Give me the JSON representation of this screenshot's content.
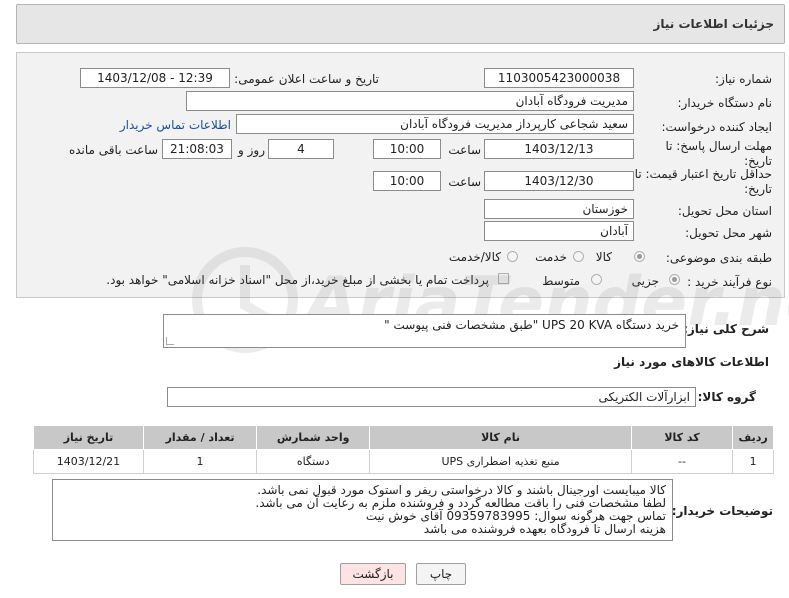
{
  "page_title": "جزئیات اطلاعات نیاز",
  "labels": {
    "need_number": "شماره نیاز:",
    "announce_datetime": "تاریخ و ساعت اعلان عمومی:",
    "buyer_org": "نام دستگاه خریدار:",
    "requester": "ایجاد کننده درخواست:",
    "reply_deadline": "مهلت ارسال پاسخ: تا تاریخ:",
    "price_validity": "حداقل تاریخ اعتبار قیمت: تا تاریخ:",
    "time": "ساعت",
    "day_and": "روز و",
    "remaining_time": "ساعت باقی مانده",
    "province": "استان محل تحویل:",
    "city": "شهر محل تحویل:",
    "category": "طبقه بندی موضوعی:",
    "purchase_process": "نوع فرآیند خرید :",
    "general_desc": "شرح کلی نیاز:",
    "goods_info": "اطلاعات کالاهای مورد نیاز",
    "goods_group": "گروه کالا:",
    "buyer_notes": "توضیحات خریدار:"
  },
  "values": {
    "need_number": "1103005423000038",
    "announce_datetime": "1403/12/08 - 12:39",
    "buyer_org": "مدیریت فرودگاه آبادان",
    "requester": "سعید شجاعی کارپرداز مدیریت فرودگاه آبادان",
    "contact_link": "اطلاعات تماس خریدار",
    "reply_date": "1403/12/13",
    "reply_time": "10:00",
    "remaining_days": "4",
    "remaining_clock": "21:08:03",
    "validity_date": "1403/12/30",
    "validity_time": "10:00",
    "province": "خوزستان",
    "city": "آبادان",
    "general_desc": "خرید دستگاه UPS 20 KVA \"طبق مشخصات فنی پیوست \"",
    "goods_group": "ابزارآلات الکتریکی"
  },
  "category_options": [
    "کالا",
    "خدمت",
    "کالا/خدمت"
  ],
  "category_selected": "کالا",
  "process_options": [
    "جزیی",
    "متوسط"
  ],
  "process_selected": "جزیی",
  "payment_note": "پرداخت تمام یا بخشی از مبلغ خرید،از محل \"اسناد خزانه اسلامی\" خواهد بود.",
  "table": {
    "headers": [
      "ردیف",
      "کد کالا",
      "نام کالا",
      "واحد شمارش",
      "تعداد / مقدار",
      "تاریخ نیاز"
    ],
    "rows": [
      [
        "1",
        "--",
        "منبع تغذیه اضطراری UPS",
        "دستگاه",
        "1",
        "1403/12/21"
      ]
    ]
  },
  "notes_lines": [
    "کالا میبایست اورجینال باشند و کالا درخواستی ریفر و استوک مورد قبول نمی باشد.",
    "لطفا مشخصات فنی را باقت مطالعه گردد و فروشنده ملزم به رعایت آن می باشد.",
    "تماس جهت هرگونه سوال: 09359783995 آقای خوش نیت",
    "هزینه ارسال تا فرودگاه بعهده فروشنده می باشد"
  ],
  "buttons": {
    "return": "بازگشت",
    "print": "چاپ"
  },
  "colors": {
    "return_button_bg": "#fde3e3",
    "panel_bg": "#f2f2f2",
    "header_bg": "#c8c8c8",
    "link": "#1a4fa3"
  },
  "watermark_text": "AriaTender.neT"
}
